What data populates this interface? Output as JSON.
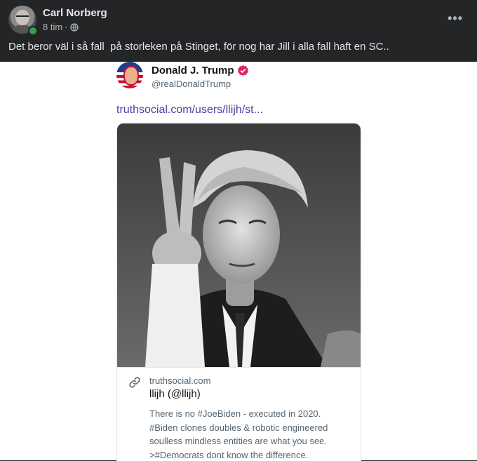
{
  "post": {
    "author": "Carl Norberg",
    "time": "8 tim",
    "separator": "·",
    "privacy_icon": "globe-icon",
    "more_icon": "more-options-icon",
    "more_label": "•••",
    "text": "Det beror väl i så fall  på storleken på Stinget, för nog har Jill i alla fall haft en SC.."
  },
  "shared": {
    "author_name": "Donald J. Trump",
    "handle": "@realDonaldTrump",
    "verified_icon": "verified-badge-icon",
    "link_text": "truthsocial.com/users/llijh/st...",
    "card": {
      "domain": "truthsocial.com",
      "title": "llijh (@llijh)",
      "description_lines": [
        "There is no #JoeBiden - executed in 2020.",
        "#Biden clones doubles & robotic engineered",
        "soulless mindless entities are what you see.",
        ">#Democrats dont know the difference."
      ]
    }
  },
  "colors": {
    "bg_dark": "#242526",
    "text_primary": "#e4e6eb",
    "text_secondary": "#b0b3b8",
    "online": "#31a24c",
    "link": "#4a40a6",
    "verified": "#e0245e"
  }
}
